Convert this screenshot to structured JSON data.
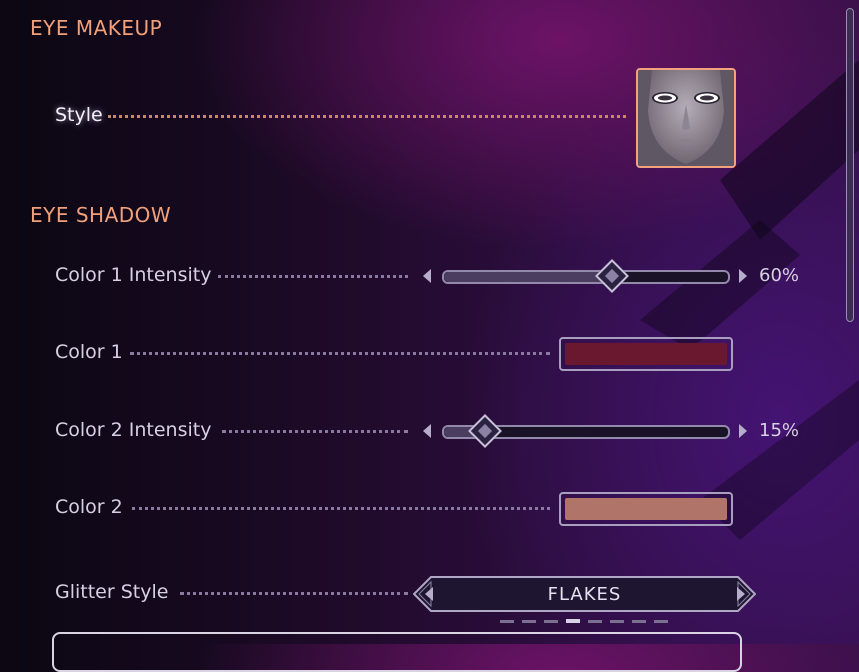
{
  "sections": {
    "eye_makeup": {
      "title": "EYE MAKEUP"
    },
    "eye_shadow": {
      "title": "EYE SHADOW"
    }
  },
  "rows": {
    "style": {
      "label": "Style"
    },
    "color1_intensity": {
      "label": "Color 1 Intensity",
      "value_text": "60%",
      "value": 0.6
    },
    "color1": {
      "label": "Color 1",
      "color": "#6a1830"
    },
    "color2_intensity": {
      "label": "Color 2 Intensity",
      "value_text": "15%",
      "value": 0.15
    },
    "color2": {
      "label": "Color 2",
      "color": "#b07468"
    },
    "glitter_style": {
      "label": "Glitter Style",
      "value": "FLAKES",
      "page_index": 3,
      "page_count": 8
    }
  },
  "icons": {
    "style_thumbnail": "face-mask-icon",
    "left": "arrow-left-icon",
    "right": "arrow-right-icon"
  },
  "colors": {
    "section_title": "#f0a07a",
    "thumbnail_border": "#f2a37d",
    "dots_neutral": "#8a7aa2"
  }
}
